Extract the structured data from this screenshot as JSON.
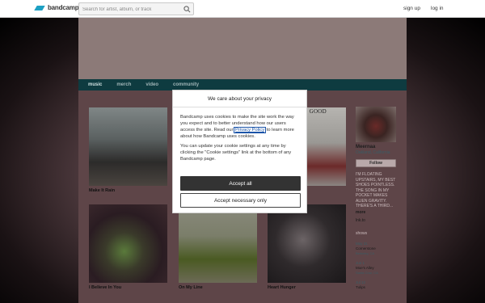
{
  "topbar": {
    "logo_text": "bandcamp",
    "search_placeholder": "Search for artist, album, or track",
    "signup_label": "sign up",
    "login_label": "log in"
  },
  "nav": {
    "items": [
      "music",
      "merch",
      "video",
      "community"
    ]
  },
  "albums": [
    {
      "title": "Make It Rain"
    },
    {
      "title": "I Believe In You"
    },
    {
      "title": "On My Line"
    },
    {
      "title": "Heart Hunger"
    },
    {
      "art_text": "FAR SO GOOD"
    }
  ],
  "sidebar": {
    "band_name": "Meernaa",
    "location": "Oakland, California",
    "follow_label": "Follow",
    "bio": "I'M FLOATING UPSTAIRS, MY BEST SHOES POINTLESS. THE SONG IN MY POCKET MAKES ALIEN GRAVITY. THERE'S A THIRD...",
    "bio_more": "more",
    "link": "lnk.to",
    "shows_heading": "shows",
    "shows": [
      {
        "date": "May 31",
        "venue": "Cornerstone",
        "loc": "Berkeley, CA"
      },
      {
        "date": "Jun 1",
        "venue": "Moe's Alley",
        "loc": "Santa Cruz, CA"
      },
      {
        "date": "Jul 12",
        "venue": "Tulips",
        "loc": ""
      }
    ]
  },
  "cookie_modal": {
    "title": "We care about your privacy",
    "para1_before": "Bandcamp uses cookies to make the site work the way you expect and to better understand how our users access the site. Read our ",
    "privacy_link": "Privacy Policy",
    "para1_after": " to learn more about how Bandcamp uses cookies.",
    "para2": "You can update your cookie settings at any time by clicking the \"Cookie settings\" link at the bottom of any Bandcamp page.",
    "accept_all_label": "Accept all",
    "accept_necessary_label": "Accept necessary only"
  },
  "colors": {
    "accent": "#1da0c3",
    "nav_bg": "#0e3b40",
    "button_dark": "#333333"
  }
}
